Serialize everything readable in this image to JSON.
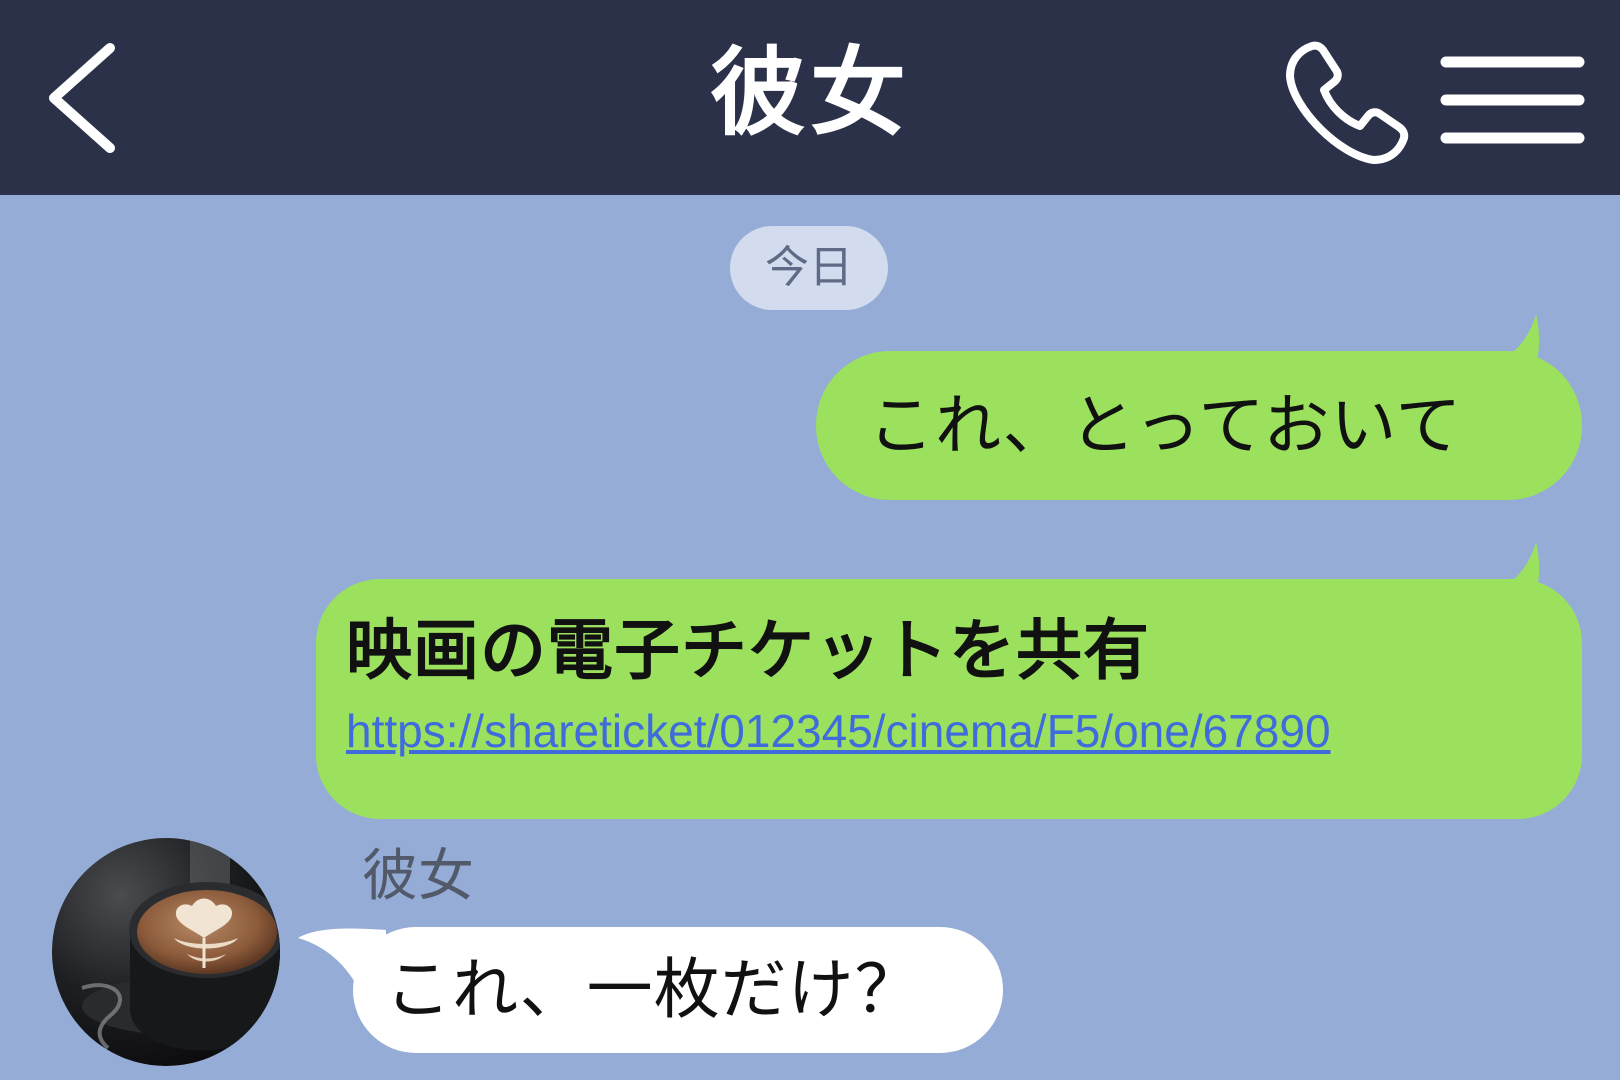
{
  "header": {
    "title": "彼女",
    "icons": {
      "back": "chevron-left-icon",
      "call": "phone-icon",
      "menu": "hamburger-menu-icon"
    }
  },
  "chat": {
    "date_label": "今日",
    "messages": [
      {
        "direction": "outgoing",
        "text": "これ、とっておいて"
      },
      {
        "direction": "outgoing",
        "text": "映画の電子チケットを共有",
        "link": "https://shareticket/012345/cinema/F5/one/67890"
      },
      {
        "direction": "incoming",
        "sender": "彼女",
        "text": "これ、一枚だけ？"
      }
    ]
  },
  "colors": {
    "header_bg": "#2a3149",
    "chat_bg": "#94acd6",
    "outgoing_bubble": "#9be15e",
    "incoming_bubble": "#ffffff",
    "link": "#3f6bdd"
  }
}
